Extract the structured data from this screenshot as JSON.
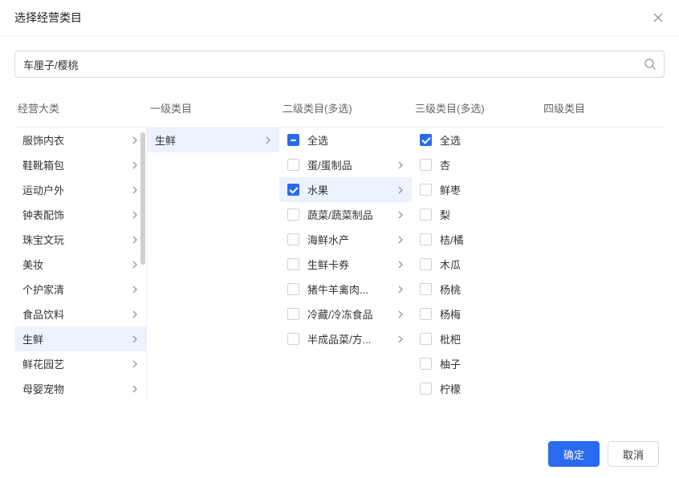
{
  "dialog": {
    "title": "选择经营类目"
  },
  "search": {
    "value": "车厘子/樱桃"
  },
  "headers": {
    "col0": "经营大类",
    "col1": "一级类目",
    "col2": "二级类目(多选)",
    "col3": "三级类目(多选)",
    "col4": "四级类目"
  },
  "col0": {
    "items": [
      {
        "label": "服饰内衣",
        "hasChildren": true,
        "selected": false
      },
      {
        "label": "鞋靴箱包",
        "hasChildren": true,
        "selected": false
      },
      {
        "label": "运动户外",
        "hasChildren": true,
        "selected": false
      },
      {
        "label": "钟表配饰",
        "hasChildren": true,
        "selected": false
      },
      {
        "label": "珠宝文玩",
        "hasChildren": true,
        "selected": false
      },
      {
        "label": "美妆",
        "hasChildren": true,
        "selected": false
      },
      {
        "label": "个护家清",
        "hasChildren": true,
        "selected": false
      },
      {
        "label": "食品饮料",
        "hasChildren": true,
        "selected": false
      },
      {
        "label": "生鲜",
        "hasChildren": true,
        "selected": true
      },
      {
        "label": "鲜花园艺",
        "hasChildren": true,
        "selected": false
      },
      {
        "label": "母婴宠物",
        "hasChildren": true,
        "selected": false
      }
    ]
  },
  "col1": {
    "items": [
      {
        "label": "生鲜",
        "hasChildren": true,
        "selected": true
      }
    ]
  },
  "col2": {
    "items": [
      {
        "label": "全选",
        "check": "indeterminate",
        "hasChildren": false,
        "selected": false
      },
      {
        "label": "蛋/蛋制品",
        "check": "unchecked",
        "hasChildren": true,
        "selected": false
      },
      {
        "label": "水果",
        "check": "checked",
        "hasChildren": true,
        "selected": true
      },
      {
        "label": "蔬菜/蔬菜制品",
        "check": "unchecked",
        "hasChildren": true,
        "selected": false
      },
      {
        "label": "海鲜水产",
        "check": "unchecked",
        "hasChildren": true,
        "selected": false
      },
      {
        "label": "生鲜卡券",
        "check": "unchecked",
        "hasChildren": true,
        "selected": false
      },
      {
        "label": "猪牛羊禽肉...",
        "check": "unchecked",
        "hasChildren": true,
        "selected": false
      },
      {
        "label": "冷藏/冷冻食品",
        "check": "unchecked",
        "hasChildren": true,
        "selected": false
      },
      {
        "label": "半成品菜/方...",
        "check": "unchecked",
        "hasChildren": true,
        "selected": false
      }
    ]
  },
  "col3": {
    "items": [
      {
        "label": "全选",
        "check": "checked"
      },
      {
        "label": "杏",
        "check": "unchecked"
      },
      {
        "label": "鲜枣",
        "check": "unchecked"
      },
      {
        "label": "梨",
        "check": "unchecked"
      },
      {
        "label": "桔/橘",
        "check": "unchecked"
      },
      {
        "label": "木瓜",
        "check": "unchecked"
      },
      {
        "label": "杨桃",
        "check": "unchecked"
      },
      {
        "label": "杨梅",
        "check": "unchecked"
      },
      {
        "label": "枇杷",
        "check": "unchecked"
      },
      {
        "label": "柚子",
        "check": "unchecked"
      },
      {
        "label": "柠檬",
        "check": "unchecked"
      }
    ]
  },
  "footer": {
    "confirm": "确定",
    "cancel": "取消"
  }
}
